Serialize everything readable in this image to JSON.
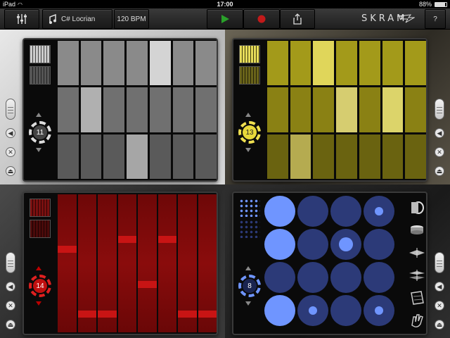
{
  "status_bar": {
    "device": "iPad",
    "time": "17:00",
    "battery": "88%",
    "battery_level": 0.88
  },
  "toolbar": {
    "mixer_icon": "sliders-icon",
    "scale_label": "C# Locrian",
    "tempo_label": "120 BPM",
    "play_icon": "play-icon",
    "record_icon": "record-icon",
    "share_icon": "share-icon",
    "brand": "SKRAM",
    "help_label": "?"
  },
  "colors": {
    "grey_panel": "#8a8a8a",
    "yellow_panel": "#a39a1a",
    "red_panel": "#7a0a0a",
    "blue_panel": "#2c3a78",
    "blue_active": "#6f95ff"
  },
  "sequencers": [
    {
      "name": "grey",
      "knob_value": "11"
    },
    {
      "name": "yellow",
      "knob_value": "13"
    },
    {
      "name": "red",
      "knob_value": "14"
    },
    {
      "name": "drums",
      "knob_value": "8"
    }
  ],
  "side_controls": [
    "scroll-handle-icon",
    "speaker-icon",
    "close-icon",
    "eject-icon"
  ],
  "drum_instruments": [
    "kick-drum-icon",
    "snare-drum-icon",
    "hihat-closed-icon",
    "hihat-open-icon",
    "cymbal-icon",
    "clap-icon"
  ]
}
